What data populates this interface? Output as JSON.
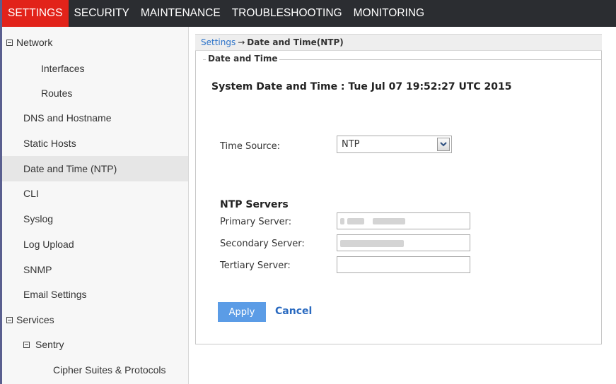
{
  "top_menu": {
    "items": [
      "SETTINGS",
      "SECURITY",
      "MAINTENANCE",
      "TROUBLESHOOTING",
      "MONITORING"
    ],
    "active": "SETTINGS",
    "active_color": "#e2231a"
  },
  "sidebar": {
    "items": [
      {
        "label": "Network",
        "expander": true,
        "level": 0
      },
      {
        "label": "Interfaces",
        "level": 2
      },
      {
        "label": "Routes",
        "level": 2
      },
      {
        "label": "DNS and Hostname",
        "level": 1
      },
      {
        "label": "Static Hosts",
        "level": 1
      },
      {
        "label": "Date and Time (NTP)",
        "level": 1,
        "selected": true
      },
      {
        "label": "CLI",
        "level": 1
      },
      {
        "label": "Syslog",
        "level": 1
      },
      {
        "label": "Log Upload",
        "level": 1
      },
      {
        "label": "SNMP",
        "level": 1
      },
      {
        "label": "Email Settings",
        "level": 1
      },
      {
        "label": "Services",
        "expander": true,
        "level": 0
      },
      {
        "label": "Sentry",
        "expander": true,
        "level": 1
      },
      {
        "label": "Cipher Suites & Protocols",
        "level": 3
      }
    ]
  },
  "breadcrumb": {
    "root": "Settings",
    "arrow": "→",
    "current": "Date and Time(NTP)"
  },
  "panel": {
    "legend": "Date and Time",
    "system_datetime": "System Date and Time : Tue Jul 07 19:52:27 UTC 2015",
    "time_source_label": "Time Source:",
    "time_source_value": "NTP",
    "ntp_heading": "NTP Servers",
    "primary_label": "Primary Server:",
    "secondary_label": "Secondary Server:",
    "tertiary_label": "Tertiary Server:",
    "tertiary_value": "",
    "apply_label": "Apply",
    "cancel_label": "Cancel"
  }
}
